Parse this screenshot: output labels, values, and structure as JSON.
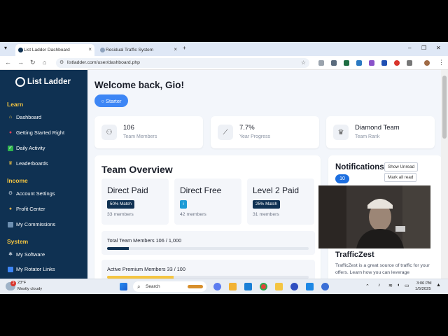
{
  "browser": {
    "tabs": [
      {
        "title": "List Ladder Dashboard",
        "active": true
      },
      {
        "title": "Residual Traffic System",
        "active": false
      }
    ],
    "url": "listladder.com/user/dashboard.php"
  },
  "sidebar": {
    "logo": "List Ladder",
    "sections": [
      {
        "title": "Learn",
        "items": [
          {
            "label": "Dashboard",
            "icon": "home-icon"
          },
          {
            "label": "Getting Started Right",
            "icon": "pin-icon"
          },
          {
            "label": "Daily Activity",
            "icon": "check-icon"
          },
          {
            "label": "Leaderboards",
            "icon": "trophy-icon"
          }
        ]
      },
      {
        "title": "Income",
        "items": [
          {
            "label": "Account Settings",
            "icon": "gear-icon"
          },
          {
            "label": "Profit Center",
            "icon": "money-bag-icon"
          },
          {
            "label": "My Commissions",
            "icon": "wallet-icon"
          }
        ]
      },
      {
        "title": "System",
        "items": [
          {
            "label": "My Software",
            "icon": "tools-icon"
          },
          {
            "label": "My Rotator Links",
            "icon": "link-icon"
          }
        ]
      }
    ]
  },
  "main": {
    "welcome": "Welcome back, Gio!",
    "badge": "Starter",
    "stats": [
      {
        "value": "106",
        "label": "Team Members",
        "icon": "users-icon"
      },
      {
        "value": "7.7%",
        "label": "Year Progress",
        "icon": "chart-line-icon"
      },
      {
        "value": "Diamond Team",
        "label": "Team Rank",
        "icon": "trophy-icon"
      }
    ],
    "team_overview": {
      "title": "Team Overview",
      "tiers": [
        {
          "name": "Direct Paid",
          "badge": "50% Match",
          "members": "33 members"
        },
        {
          "name": "Direct Free",
          "badge": "i",
          "members": "42 members"
        },
        {
          "name": "Level 2 Paid",
          "badge": "25% Match",
          "members": "31 members"
        }
      ],
      "progress": [
        {
          "label": "Total Team Members 106 / 1,000",
          "fraction": 0.106,
          "color": "#0f3152"
        },
        {
          "label": "Active Premium Members 33 / 100",
          "fraction": 0.33,
          "color": "#f4c542"
        }
      ]
    },
    "notifications": {
      "title": "Notifications",
      "count": "10",
      "show_unread": "Show Unread",
      "mark_all": "Mark all read",
      "item_title": "TrafficZest",
      "item_text": "TrafficZest is a great source of traffic for your offers. Learn how you can leverage"
    }
  },
  "taskbar": {
    "weather_badge": "2",
    "weather_temp": "23°F",
    "weather_desc": "Mostly cloudy",
    "search": "Search",
    "time": "3:06 PM",
    "date": "1/5/2025"
  }
}
